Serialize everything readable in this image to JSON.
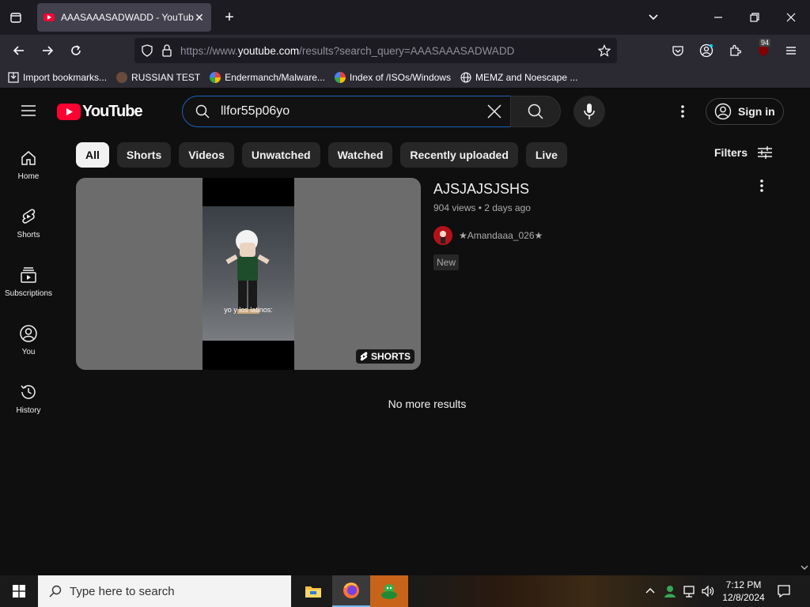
{
  "browser": {
    "tab_title": "AAASAAASADWADD - YouTube",
    "url_prefix": "https://www.",
    "url_host": "youtube.com",
    "url_path": "/results?search_query=AAASAAASADWADD",
    "extension_badge": "94",
    "bookmarks": [
      {
        "label": "Import bookmarks...",
        "icon": "import-icon"
      },
      {
        "label": "RUSSIAN TEST",
        "icon": "circle-icon"
      },
      {
        "label": "Endermanch/Malware...",
        "icon": "google-icon"
      },
      {
        "label": "Index of /ISOs/Windows",
        "icon": "google-icon"
      },
      {
        "label": "MEMZ and Noescape ...",
        "icon": "globe-icon"
      }
    ]
  },
  "youtube": {
    "logo_text": "YouTube",
    "search_value": "llfor55p06yo",
    "signin_label": "Sign in",
    "sidebar": [
      {
        "label": "Home",
        "icon": "home-icon"
      },
      {
        "label": "Shorts",
        "icon": "shorts-icon"
      },
      {
        "label": "Subscriptions",
        "icon": "subscriptions-icon"
      },
      {
        "label": "You",
        "icon": "you-icon"
      },
      {
        "label": "History",
        "icon": "history-icon"
      }
    ],
    "chips": [
      "All",
      "Shorts",
      "Videos",
      "Unwatched",
      "Watched",
      "Recently uploaded",
      "Live"
    ],
    "filters_label": "Filters",
    "result": {
      "title": "AJSJAJSJSHS",
      "stats": "904 views • 2 days ago",
      "channel": "★Amandaaa_026★",
      "badge": "New",
      "thumbnail_caption": "yo y los latinos:",
      "shorts_badge": "SHORTS"
    },
    "no_more_results": "No more results"
  },
  "taskbar": {
    "search_placeholder": "Type here to search",
    "time": "7:12 PM",
    "date": "12/8/2024"
  },
  "colors": {
    "yt_red": "#ff0033",
    "yt_bg": "#0f0f0f",
    "search_focus": "#1c62b9"
  }
}
